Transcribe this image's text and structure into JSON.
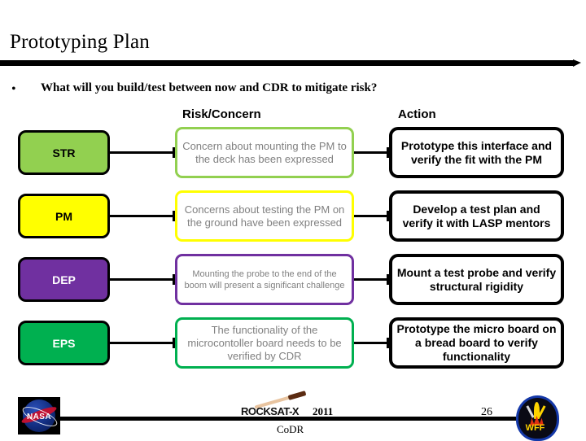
{
  "slide": {
    "title": "Prototyping Plan",
    "bullet_marker": "•",
    "bullet_text": "What will you build/test between now and CDR to mitigate risk?"
  },
  "columns": {
    "risk_header": "Risk/Concern",
    "action_header": "Action"
  },
  "rows": [
    {
      "subsystem": "STR",
      "subsystem_bg": "#92D050",
      "subsystem_color": "#000000",
      "risk": "Concern about mounting the PM to the deck has been expressed",
      "risk_border": "#92D050",
      "action": "Prototype this interface and verify the fit with the PM"
    },
    {
      "subsystem": "PM",
      "subsystem_bg": "#FFFF00",
      "subsystem_color": "#000000",
      "risk": "Concerns about testing the PM on the ground have been expressed",
      "risk_border": "#FFFF00",
      "action": "Develop a test plan and verify it with LASP mentors"
    },
    {
      "subsystem": "DEP",
      "subsystem_bg": "#7030A0",
      "subsystem_color": "#FFFFFF",
      "risk": "Mounting the probe to the end of the boom will present a significant challenge",
      "risk_border": "#7030A0",
      "action": "Mount a test probe and verify structural rigidity"
    },
    {
      "subsystem": "EPS",
      "subsystem_bg": "#00B050",
      "subsystem_color": "#FFFFFF",
      "risk": "The functionality of the microcontoller board needs to be verified by CDR",
      "risk_border": "#00B050",
      "action": "Prototype the micro board on a bread board to verify functionality"
    }
  ],
  "footer": {
    "nasa_label": "NASA",
    "rocksat_word": "ROCKSAT-X",
    "rocksat_year": "2011",
    "rocksat_codr": "CoDR",
    "page_number": "26",
    "wff_label": "WFF"
  }
}
